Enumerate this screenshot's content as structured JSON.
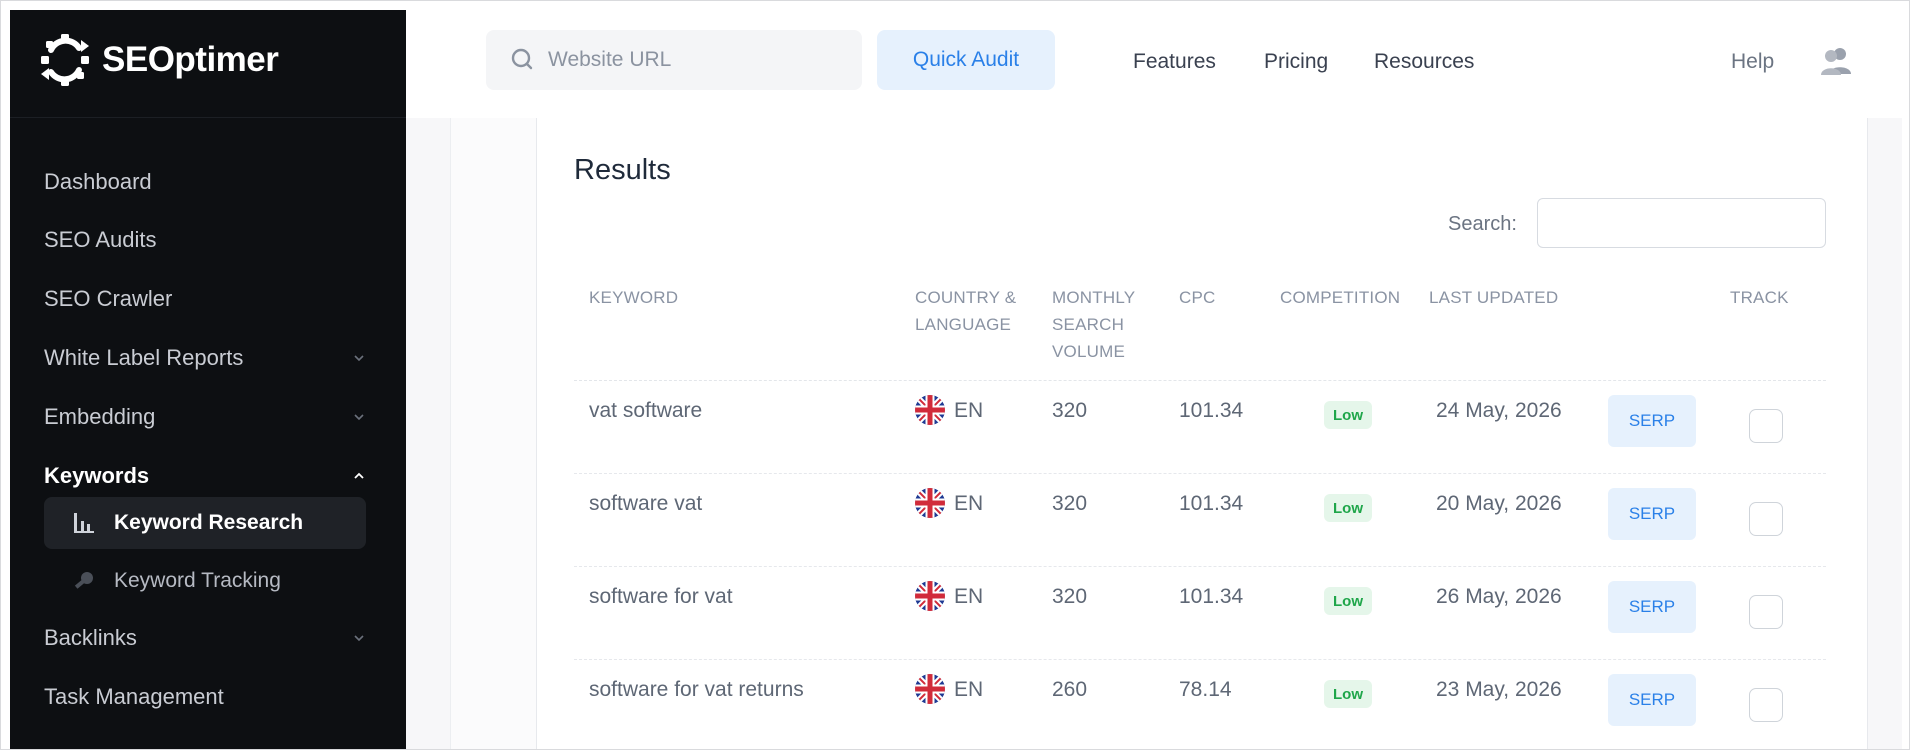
{
  "app": {
    "name": "SEOptimer"
  },
  "sidebar": {
    "items": [
      {
        "label": "Dashboard"
      },
      {
        "label": "SEO Audits"
      },
      {
        "label": "SEO Crawler"
      },
      {
        "label": "White Label Reports",
        "expandable": true
      },
      {
        "label": "Embedding",
        "expandable": true
      },
      {
        "label": "Keywords",
        "expanded": true,
        "active": true
      },
      {
        "label": "Backlinks",
        "expandable": true
      },
      {
        "label": "Task Management"
      }
    ],
    "subitems": [
      {
        "label": "Keyword Research",
        "icon": "bar-chart-icon",
        "active": true
      },
      {
        "label": "Keyword Tracking",
        "icon": "key-icon"
      }
    ]
  },
  "topbar": {
    "url_placeholder": "Website URL",
    "quick_audit": "Quick Audit",
    "nav": [
      "Features",
      "Pricing",
      "Resources"
    ],
    "help": "Help"
  },
  "results": {
    "title": "Results",
    "search_label": "Search:",
    "columns": {
      "keyword": "KEYWORD",
      "country_1": "COUNTRY &",
      "country_2": "LANGUAGE",
      "volume_1": "MONTHLY",
      "volume_2": "SEARCH",
      "volume_3": "VOLUME",
      "cpc": "CPC",
      "competition": "COMPETITION",
      "last_updated": "LAST UPDATED",
      "track": "TRACK"
    },
    "rows": [
      {
        "keyword": "vat software",
        "lang": "EN",
        "volume": "320",
        "cpc": "101.34",
        "competition": "Low",
        "updated": "24 May, 2026",
        "serp": "SERP",
        "tracked": false
      },
      {
        "keyword": "software vat",
        "lang": "EN",
        "volume": "320",
        "cpc": "101.34",
        "competition": "Low",
        "updated": "20 May, 2026",
        "serp": "SERP",
        "tracked": false
      },
      {
        "keyword": "software for vat",
        "lang": "EN",
        "volume": "320",
        "cpc": "101.34",
        "competition": "Low",
        "updated": "26 May, 2026",
        "serp": "SERP",
        "tracked": false
      },
      {
        "keyword": "software for vat returns",
        "lang": "EN",
        "volume": "260",
        "cpc": "78.14",
        "competition": "Low",
        "updated": "23 May, 2026",
        "serp": "SERP",
        "tracked": false
      }
    ]
  },
  "colors": {
    "sidebar_bg": "#0d0f12",
    "accent_blue": "#2a80e8",
    "accent_blue_bg": "#e6f1fd",
    "low_green": "#1fa64a",
    "low_green_bg": "#e5f6ea"
  }
}
